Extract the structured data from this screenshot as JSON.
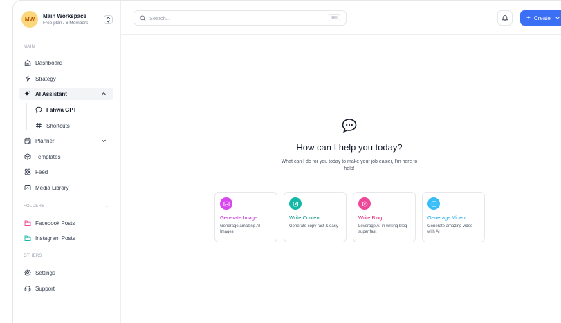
{
  "workspace": {
    "initials": "MW",
    "name": "Main Workspace",
    "plan": "Free plan / 6 Members"
  },
  "sidebar": {
    "main_label": "MAIN",
    "items": [
      {
        "label": "Dashboard",
        "icon": "home-icon"
      },
      {
        "label": "Strategy",
        "icon": "bolt-icon"
      },
      {
        "label": "AI Assistant",
        "icon": "sparkle-icon"
      },
      {
        "label": "Fahwa GPT",
        "icon": "chat-icon"
      },
      {
        "label": "Shortcuts",
        "icon": "hash-icon"
      },
      {
        "label": "Planner",
        "icon": "calendar-icon"
      },
      {
        "label": "Templates",
        "icon": "cube-icon"
      },
      {
        "label": "Feed",
        "icon": "grid-icon"
      },
      {
        "label": "Media Library",
        "icon": "image-icon"
      }
    ],
    "folders_label": "FOLDERS",
    "folders_add": "+",
    "folders": [
      {
        "label": "Facebook Posts",
        "color": "#ec4899"
      },
      {
        "label": "Instagram Posts",
        "color": "#14b8a6"
      }
    ],
    "others_label": "OTHERS",
    "others": [
      {
        "label": "Settings",
        "icon": "gear-icon"
      },
      {
        "label": "Support",
        "icon": "headset-icon"
      }
    ]
  },
  "topbar": {
    "search_placeholder": "Search...",
    "search_shortcut": "⌘K",
    "create_label": "Create"
  },
  "main": {
    "headline": "How can I help you today?",
    "subline": "What can I do for you today to make your job easier, I'm here to help!",
    "cards": [
      {
        "title": "Generate Image",
        "desc": "Generage amazing AI Images",
        "color": "#c026d3",
        "icon_bg": "#d946ef",
        "icon": "image-icon"
      },
      {
        "title": "Write Content",
        "desc": "Generate copy fast & easy",
        "color": "#0d9488",
        "icon_bg": "#14b8a6",
        "icon": "edit-icon"
      },
      {
        "title": "Write Blog",
        "desc": "Leverage AI in writing blog super fast",
        "color": "#db2777",
        "icon_bg": "#ec4899",
        "icon": "blog-icon"
      },
      {
        "title": "Generage Video",
        "desc": "Generate amazing video with AI",
        "color": "#0ea5e9",
        "icon_bg": "#38bdf8",
        "icon": "video-icon"
      }
    ]
  },
  "colors": {
    "accent": "#3b6ff5"
  }
}
